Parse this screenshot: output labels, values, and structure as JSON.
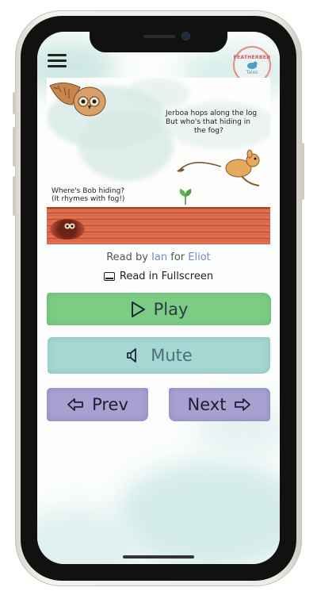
{
  "story": {
    "line1": "Jerboa hops along the log",
    "line2": "But who's that hiding in",
    "line3": "the fog?",
    "hint1": "Where's Bob hiding?",
    "hint2": "(It rhymes with fog!)"
  },
  "logo": {
    "top": "FEATHERBED",
    "bottom": "Tales"
  },
  "credit": {
    "prefix": "Read by ",
    "reader": "Ian",
    "mid": " for ",
    "listener": "Eliot"
  },
  "fullscreen_label": "Read in Fullscreen",
  "controls": {
    "play_label": "Play",
    "mute_label": "Mute",
    "prev_label": "Prev",
    "next_label": "Next"
  },
  "colors": {
    "play": "#7ccc84",
    "mute": "#a6d7d3",
    "nav": "#a7a1d2",
    "link": "#7a86c6"
  }
}
